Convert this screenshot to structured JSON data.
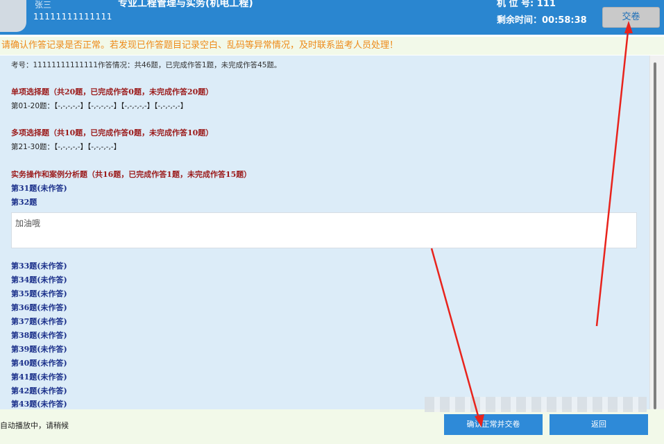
{
  "header": {
    "candidate_name": "张三",
    "candidate_id": "11111111111111",
    "exam_title": "专业工程管理与实务(机电工程)",
    "seat_label": "机 位 号: 111",
    "timer_label": "剩余时间：00:58:38",
    "submit_label": "交卷"
  },
  "notice": "请确认作答记录是否正常。若发现已作答题目记录空白、乱码等异常情况，及时联系监考人员处理！",
  "summary": "考号：11111111111111作答情况：共46题，已完成作答1题，未完成作答45题。",
  "sections": [
    {
      "title": "单项选择题（共20题，已完成作答0题，未完成作答20题）",
      "line": "第01-20题：【-,-,-,-,-】【-,-,-,-,-】【-,-,-,-,-】【-,-,-,-,-】"
    },
    {
      "title": "多项选择题（共10题，已完成作答0题，未完成作答10题）",
      "line": "第21-30题：【-,-,-,-,-】【-,-,-,-,-】"
    },
    {
      "title": "实务操作和案例分析题（共16题，已完成作答1题，未完成作答15题）"
    }
  ],
  "questions_top": [
    "第31题(未作答)",
    "第32题"
  ],
  "answer_text": "加油哦",
  "questions_rest": [
    "第33题(未作答)",
    "第34题(未作答)",
    "第35题(未作答)",
    "第36题(未作答)",
    "第37题(未作答)",
    "第38题(未作答)",
    "第39题(未作答)",
    "第40题(未作答)",
    "第41题(未作答)",
    "第42题(未作答)",
    "第43题(未作答)"
  ],
  "bottom": {
    "status": "自动播放中，请稍候",
    "confirm_label": "确认正常并交卷",
    "back_label": "返回"
  },
  "colors": {
    "header_blue": "#2a86d0",
    "notice_orange": "#ed8a19",
    "section_red": "#9b1b1b",
    "question_blue": "#1a2f8a",
    "annotation_arrow": "#e8231c"
  }
}
